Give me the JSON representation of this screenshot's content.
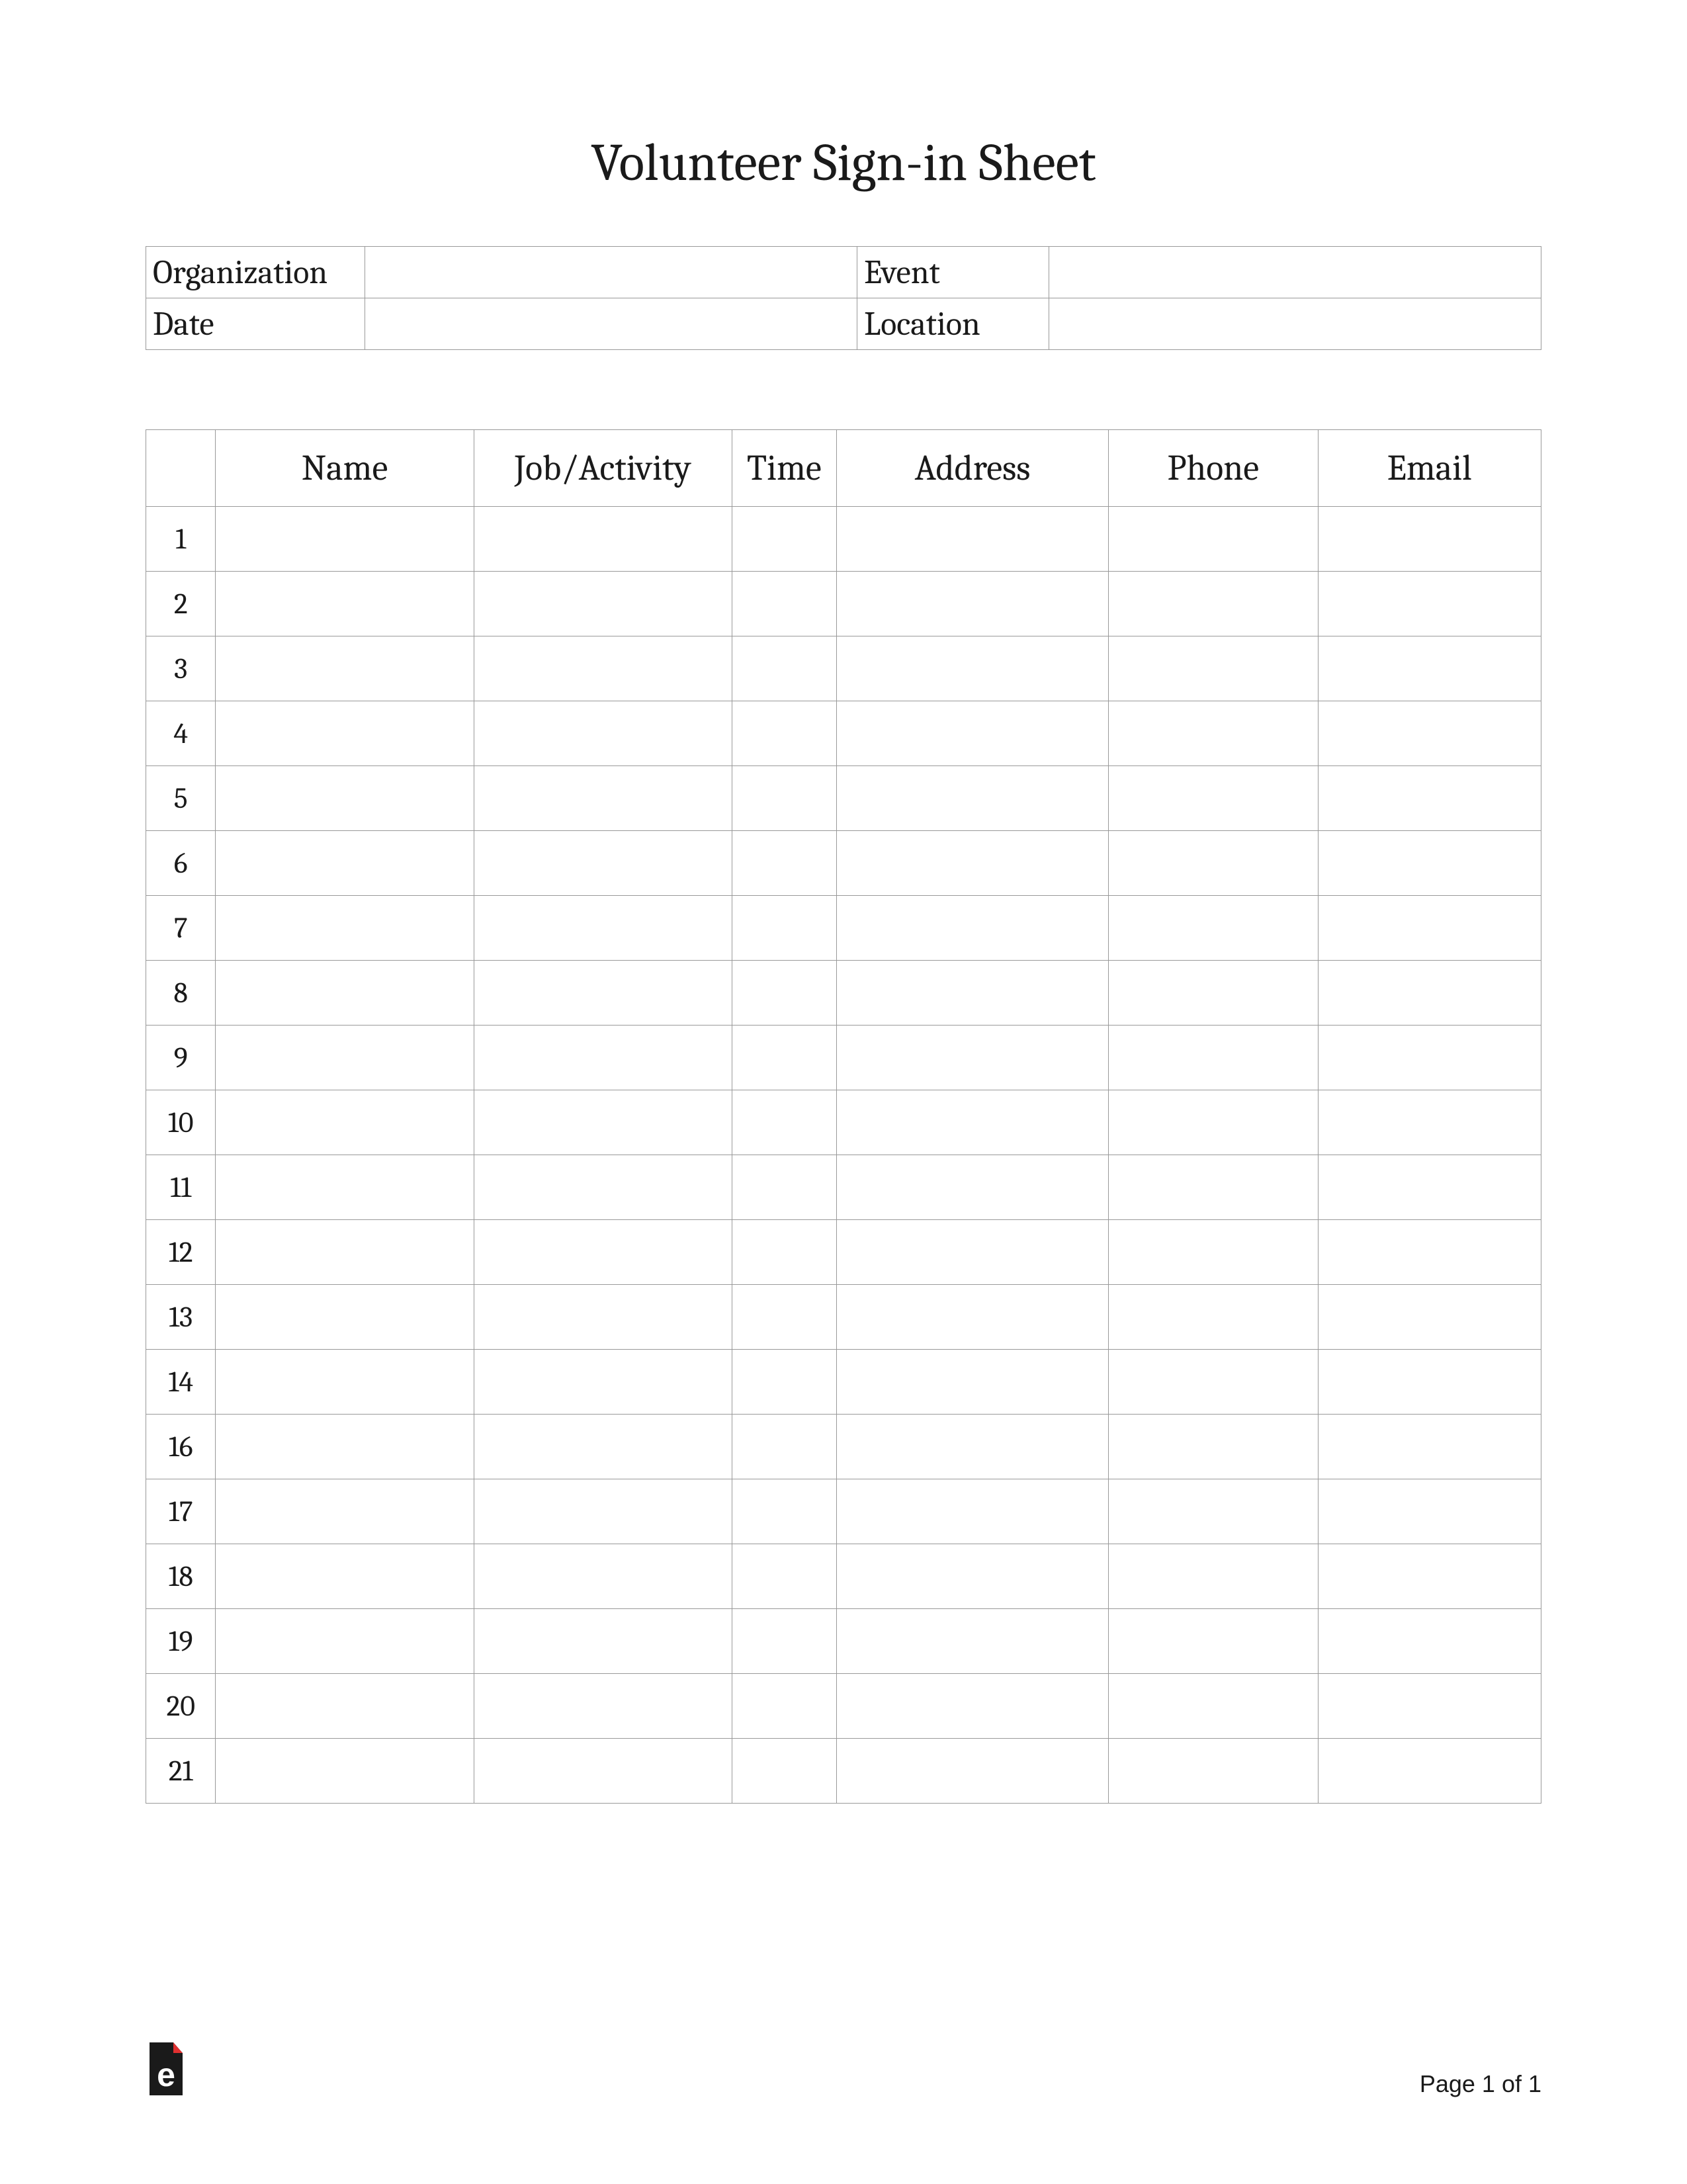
{
  "title": "Volunteer Sign-in Sheet",
  "header": {
    "organization_label": "Organization",
    "organization_value": "",
    "event_label": "Event",
    "event_value": "",
    "date_label": "Date",
    "date_value": "",
    "location_label": "Location",
    "location_value": ""
  },
  "columns": {
    "num": "",
    "name": "Name",
    "job": "Job/Activity",
    "time": "Time",
    "address": "Address",
    "phone": "Phone",
    "email": "Email"
  },
  "rows": [
    {
      "num": "1",
      "name": "",
      "job": "",
      "time": "",
      "address": "",
      "phone": "",
      "email": ""
    },
    {
      "num": "2",
      "name": "",
      "job": "",
      "time": "",
      "address": "",
      "phone": "",
      "email": ""
    },
    {
      "num": "3",
      "name": "",
      "job": "",
      "time": "",
      "address": "",
      "phone": "",
      "email": ""
    },
    {
      "num": "4",
      "name": "",
      "job": "",
      "time": "",
      "address": "",
      "phone": "",
      "email": ""
    },
    {
      "num": "5",
      "name": "",
      "job": "",
      "time": "",
      "address": "",
      "phone": "",
      "email": ""
    },
    {
      "num": "6",
      "name": "",
      "job": "",
      "time": "",
      "address": "",
      "phone": "",
      "email": ""
    },
    {
      "num": "7",
      "name": "",
      "job": "",
      "time": "",
      "address": "",
      "phone": "",
      "email": ""
    },
    {
      "num": "8",
      "name": "",
      "job": "",
      "time": "",
      "address": "",
      "phone": "",
      "email": ""
    },
    {
      "num": "9",
      "name": "",
      "job": "",
      "time": "",
      "address": "",
      "phone": "",
      "email": ""
    },
    {
      "num": "10",
      "name": "",
      "job": "",
      "time": "",
      "address": "",
      "phone": "",
      "email": ""
    },
    {
      "num": "11",
      "name": "",
      "job": "",
      "time": "",
      "address": "",
      "phone": "",
      "email": ""
    },
    {
      "num": "12",
      "name": "",
      "job": "",
      "time": "",
      "address": "",
      "phone": "",
      "email": ""
    },
    {
      "num": "13",
      "name": "",
      "job": "",
      "time": "",
      "address": "",
      "phone": "",
      "email": ""
    },
    {
      "num": "14",
      "name": "",
      "job": "",
      "time": "",
      "address": "",
      "phone": "",
      "email": ""
    },
    {
      "num": "16",
      "name": "",
      "job": "",
      "time": "",
      "address": "",
      "phone": "",
      "email": ""
    },
    {
      "num": "17",
      "name": "",
      "job": "",
      "time": "",
      "address": "",
      "phone": "",
      "email": ""
    },
    {
      "num": "18",
      "name": "",
      "job": "",
      "time": "",
      "address": "",
      "phone": "",
      "email": ""
    },
    {
      "num": "19",
      "name": "",
      "job": "",
      "time": "",
      "address": "",
      "phone": "",
      "email": ""
    },
    {
      "num": "20",
      "name": "",
      "job": "",
      "time": "",
      "address": "",
      "phone": "",
      "email": ""
    },
    {
      "num": "21",
      "name": "",
      "job": "",
      "time": "",
      "address": "",
      "phone": "",
      "email": ""
    }
  ],
  "footer": {
    "page": "Page 1 of 1"
  }
}
